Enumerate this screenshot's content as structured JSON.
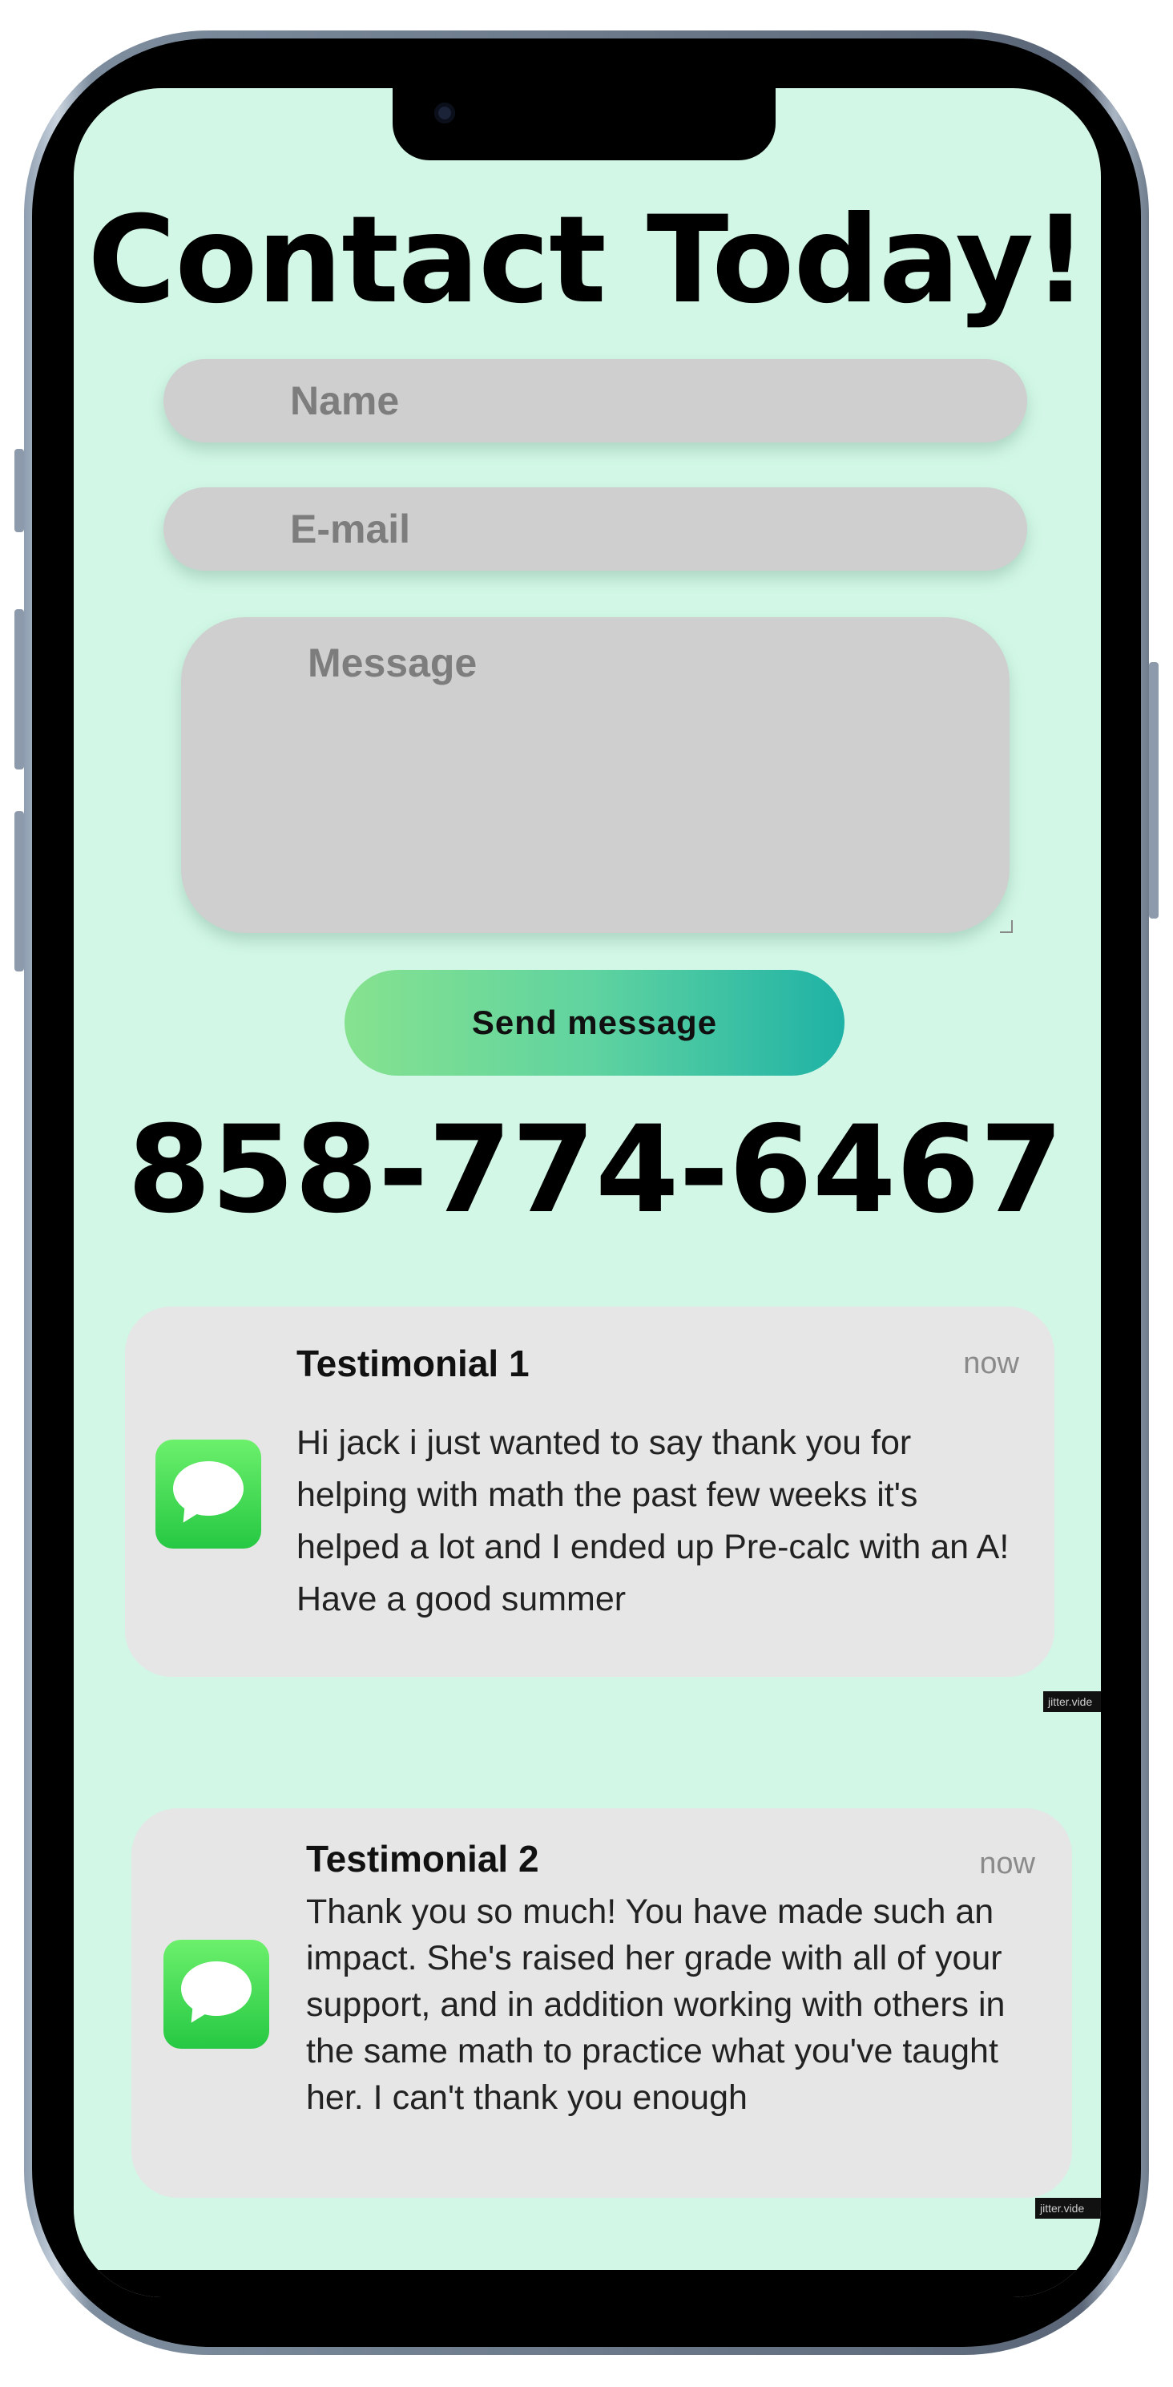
{
  "page": {
    "title": "Contact Today!",
    "phone": "858-774-6467"
  },
  "form": {
    "name_placeholder": "Name",
    "email_placeholder": "E-mail",
    "message_placeholder": "Message",
    "send_label": "Send message"
  },
  "testimonials": [
    {
      "title": "Testimonial 1",
      "time": "now",
      "body": "Hi jack i just wanted to say thank you for helping with math the past few weeks it's helped a lot and I ended up Pre-calc with an A! Have a good summer",
      "icon": "messages-app-icon"
    },
    {
      "title": "Testimonial 2",
      "time": "now",
      "body": "Thank you so much! You have made such an impact. She's raised her grade with all of your support, and in addition working with others in the same math to practice what you've taught her. I can't thank you enough",
      "icon": "messages-app-icon"
    }
  ],
  "watermarks": [
    "jitter.vide",
    "jitter.vide"
  ],
  "colors": {
    "background": "#d2f7e6",
    "field": "#cfcfcf",
    "button_start": "#86e28f",
    "button_end": "#1fb2a6",
    "card": "#e6e6e6"
  }
}
